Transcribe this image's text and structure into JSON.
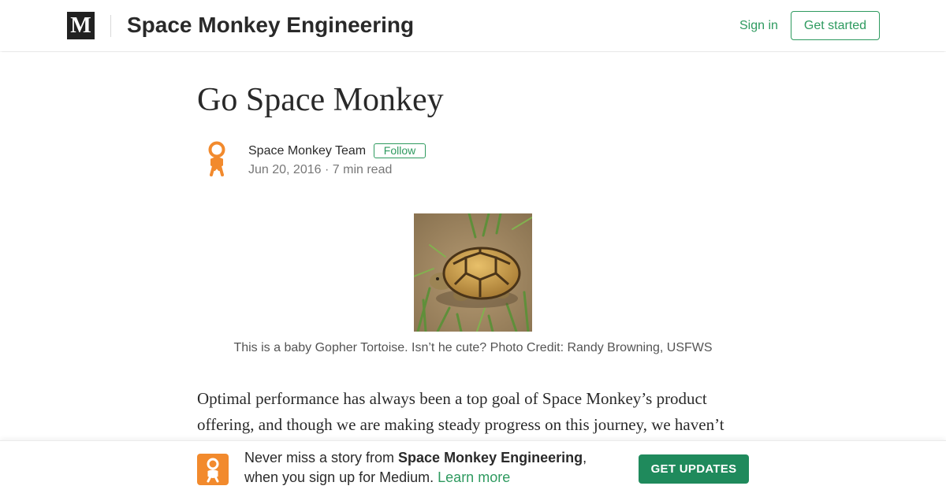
{
  "nav": {
    "logo_letter": "M",
    "publication_title": "Space Monkey Engineering",
    "sign_in_label": "Sign in",
    "get_started_label": "Get started"
  },
  "article": {
    "title": "Go Space Monkey",
    "author": {
      "name": "Space Monkey Team",
      "follow_label": "Follow",
      "date": "Jun 20, 2016",
      "separator": "·",
      "read_time": "7 min read"
    },
    "figure": {
      "caption": "This is a baby Gopher Tortoise. Isn’t he cute? Photo Credit: Randy Browning, USFWS"
    },
    "body_text": "Optimal performance has always been a top goal of Space Monkey’s product offering, and though we are making steady progress on this journey, we haven’t"
  },
  "banner": {
    "text_prefix": "Never miss a story from ",
    "publication": "Space Monkey Engineering",
    "text_suffix": ",",
    "text_line2": "when you sign up for Medium.",
    "learn_more_label": "Learn more",
    "get_updates_label": "GET UPDATES"
  },
  "colors": {
    "accent_green": "#2e9a5f",
    "button_green": "#1f8a5c",
    "brand_orange": "#f28a2d",
    "logo_dark": "#212121"
  },
  "icons": {
    "publisher_logo": "medium-m-icon",
    "author_avatar": "space-monkey-icon",
    "banner_logo": "space-monkey-icon"
  }
}
